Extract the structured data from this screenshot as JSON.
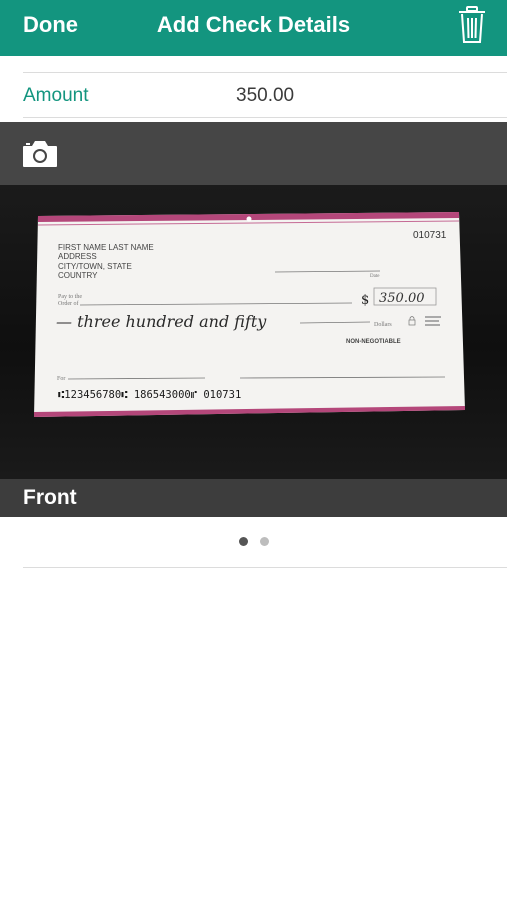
{
  "nav": {
    "done_label": "Done",
    "title": "Add Check Details",
    "trash_icon": "trash-icon"
  },
  "amount": {
    "label": "Amount",
    "value": "350.00"
  },
  "photo": {
    "camera_icon": "camera-icon",
    "caption": "Front",
    "check": {
      "check_number": "010731",
      "payer_lines": [
        "FIRST NAME LAST NAME",
        "ADDRESS",
        "CITY/TOWN, STATE",
        "COUNTRY"
      ],
      "date_label": "Date",
      "pay_to_label": "Pay to the",
      "order_of_label": "Order of",
      "dollar_sign": "$",
      "written_amount": "350.00",
      "written_words": "— three hundred and fifty",
      "dollars_label": "Dollars",
      "non_negotiable": "NON-NEGOTIABLE",
      "for_label": "For",
      "micr_line": "⑆123456780⑆ 186543000⑈ 010731"
    }
  },
  "pager": {
    "count": 2,
    "active_index": 0
  },
  "colors": {
    "accent": "#13957f",
    "check_stripe": "#b4477a"
  }
}
